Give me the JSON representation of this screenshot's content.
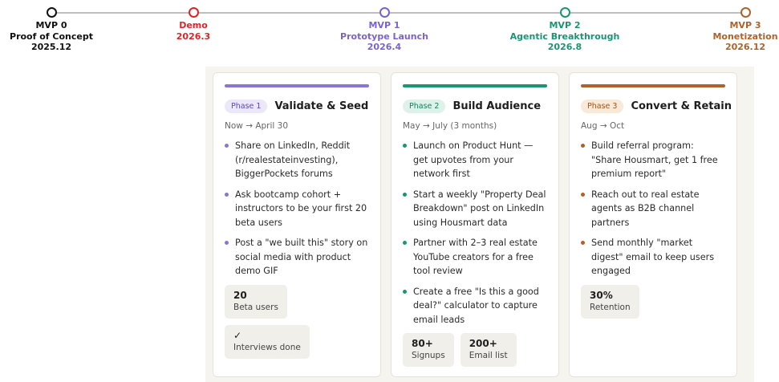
{
  "timeline": {
    "milestones": [
      {
        "line1": "MVP 0",
        "line2": "Proof of Concept",
        "line3": "2025.12",
        "color": "#111111"
      },
      {
        "line1": "Demo",
        "line2": "2026.3",
        "line3": "",
        "color": "#e02424"
      },
      {
        "line1": "MVP 1",
        "line2": "Prototype Launch",
        "line3": "2026.4",
        "color": "#7b62d2"
      },
      {
        "line1": "MVP 2",
        "line2": "Agentic Breakthrough",
        "line3": "2026.8",
        "color": "#1a9670"
      },
      {
        "line1": "MVP 3",
        "line2": "Monetization",
        "line3": "2026.12",
        "color": "#b0622a"
      }
    ]
  },
  "phases": [
    {
      "badge": "Phase 1",
      "title": "Validate & Seed",
      "period": "Now → April 30",
      "accent": "#8b76d6",
      "badge_bg": "#ece8fa",
      "badge_fg": "#5d49b8",
      "items": [
        "Share on LinkedIn, Reddit (r/realestateinvesting), BiggerPockets forums",
        "Ask bootcamp cohort + instructors to be your first 20 beta users",
        "Post a \"we built this\" story on social media with product demo GIF"
      ],
      "stats": [
        {
          "value": "20",
          "caption": "Beta users"
        },
        {
          "value": "✓",
          "caption": "Interviews done"
        }
      ]
    },
    {
      "badge": "Phase 2",
      "title": "Build Audience",
      "period": "May → July (3 months)",
      "accent": "#1a9670",
      "badge_bg": "#dff2ea",
      "badge_fg": "#17805f",
      "items": [
        "Launch on Product Hunt — get upvotes from your network first",
        "Start a weekly \"Property Deal Breakdown\" post on LinkedIn using Housmart data",
        "Partner with 2–3 real estate YouTube creators for a free tool review",
        "Create a free \"Is this a good deal?\" calculator to capture email leads"
      ],
      "stats": [
        {
          "value": "80+",
          "caption": "Signups"
        },
        {
          "value": "200+",
          "caption": "Email list"
        }
      ]
    },
    {
      "badge": "Phase 3",
      "title": "Convert & Retain",
      "period": "Aug → Oct",
      "accent": "#b0622a",
      "badge_bg": "#f8e9d9",
      "badge_fg": "#a0541d",
      "items": [
        "Build referral program: \"Share Housmart, get 1 free premium report\"",
        "Reach out to real estate agents as B2B channel partners",
        "Send monthly \"market digest\" email to keep users engaged"
      ],
      "stats": [
        {
          "value": "30%",
          "caption": "Retention"
        }
      ]
    }
  ]
}
